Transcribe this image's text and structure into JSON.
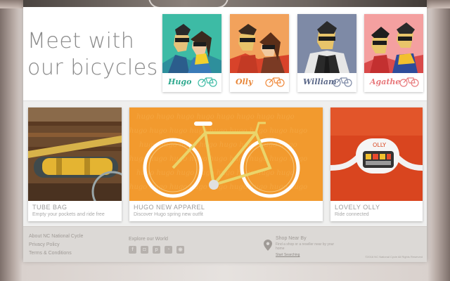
{
  "meet": {
    "title_line1": "Meet with",
    "title_line2": "our bicycles"
  },
  "bicycles": [
    {
      "name": "Hugo",
      "bg": "#3dbba5",
      "name_color": "#2fa98f",
      "bike_color": "#3dbba5"
    },
    {
      "name": "Olly",
      "bg": "#f2a25c",
      "name_color": "#e8873a",
      "bike_color": "#f08a3c"
    },
    {
      "name": "William",
      "bg": "#7e8aa6",
      "name_color": "#5d6a8a",
      "bike_color": "#7e8aa6"
    },
    {
      "name": "Agathe",
      "bg": "#f4a0a0",
      "name_color": "#e8797c",
      "bike_color": "#e87a7d"
    }
  ],
  "tiles": [
    {
      "title": "TUBE BAG",
      "subtitle": "Empty your pockets and ride free"
    },
    {
      "title": "HUGO NEW APPAREL",
      "subtitle": "Discover Hugo spring new outfit"
    },
    {
      "title": "LOVELY OLLY",
      "subtitle": "Ride connected"
    }
  ],
  "footer": {
    "links": [
      "About NC National Cycle",
      "Privacy Policy",
      "Terms & Conditions"
    ],
    "explore_label": "Explore our World",
    "social": [
      {
        "icon": "facebook-icon",
        "glyph": "f"
      },
      {
        "icon": "instagram-icon",
        "glyph": "◘"
      },
      {
        "icon": "pinterest-icon",
        "glyph": "p"
      },
      {
        "icon": "wechat-icon",
        "glyph": "◔"
      },
      {
        "icon": "weibo-icon",
        "glyph": "◉"
      }
    ],
    "shop_title": "Shop Near By",
    "shop_desc": "Find a shop or a reseller near by your home",
    "shop_link": "Start Searching",
    "copyright": "©2016 NC National Cycle All Rights Reserved"
  },
  "colors": {
    "tile_orange": "#f29a2e",
    "olly_red": "#d9451f",
    "bag_yellow": "#e4b432"
  }
}
